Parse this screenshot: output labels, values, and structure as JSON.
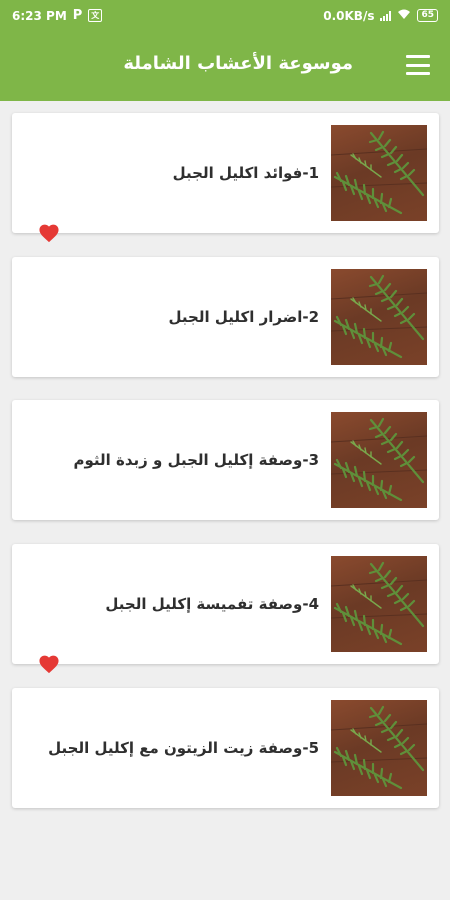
{
  "status_bar": {
    "time": "6:23 PM",
    "p_icon_label": "P",
    "speed": "0.0KB/s",
    "battery": "65"
  },
  "app_bar": {
    "title": "موسوعة الأعشاب الشاملة"
  },
  "articles": [
    {
      "title": "1-فوائد اكليل الجبل",
      "favorite": true
    },
    {
      "title": "2-اضرار اكليل الجبل",
      "favorite": false
    },
    {
      "title": "3-وصفة إكليل الجبل و زبدة الثوم",
      "favorite": false
    },
    {
      "title": "4-وصفة تفميسة إكليل الجبل",
      "favorite": true
    },
    {
      "title": "5-وصفة زيت الزيتون مع إكليل الجبل",
      "favorite": false
    }
  ],
  "colors": {
    "primary": "#7fb648",
    "heart": "#e53935",
    "background": "#efefef"
  }
}
